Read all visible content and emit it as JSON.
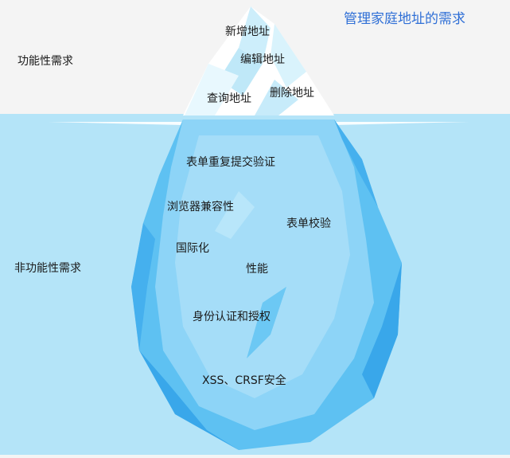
{
  "title": "管理家庭地址的需求",
  "colors": {
    "sky": "#f4f4f4",
    "water": "#b4e4f8",
    "ice_tip": "#ffffff",
    "ice_shadow": "#b3e2f5",
    "berg_light": "#8dd4f7",
    "berg_mid": "#5ec1f2",
    "berg_dark": "#39a7ea",
    "title": "#2f6fd6"
  },
  "sections": {
    "functional": "功能性需求",
    "non_functional": "非功能性需求"
  },
  "above_water": {
    "add": "新增地址",
    "edit": "编辑地址",
    "query": "查询地址",
    "delete": "删除地址"
  },
  "below_water": {
    "dup_submit": "表单重复提交验证",
    "browser_compat": "浏览器兼容性",
    "form_validation": "表单校验",
    "i18n": "国际化",
    "performance": "性能",
    "auth": "身份认证和授权",
    "security": "XSS、CRSF安全"
  }
}
